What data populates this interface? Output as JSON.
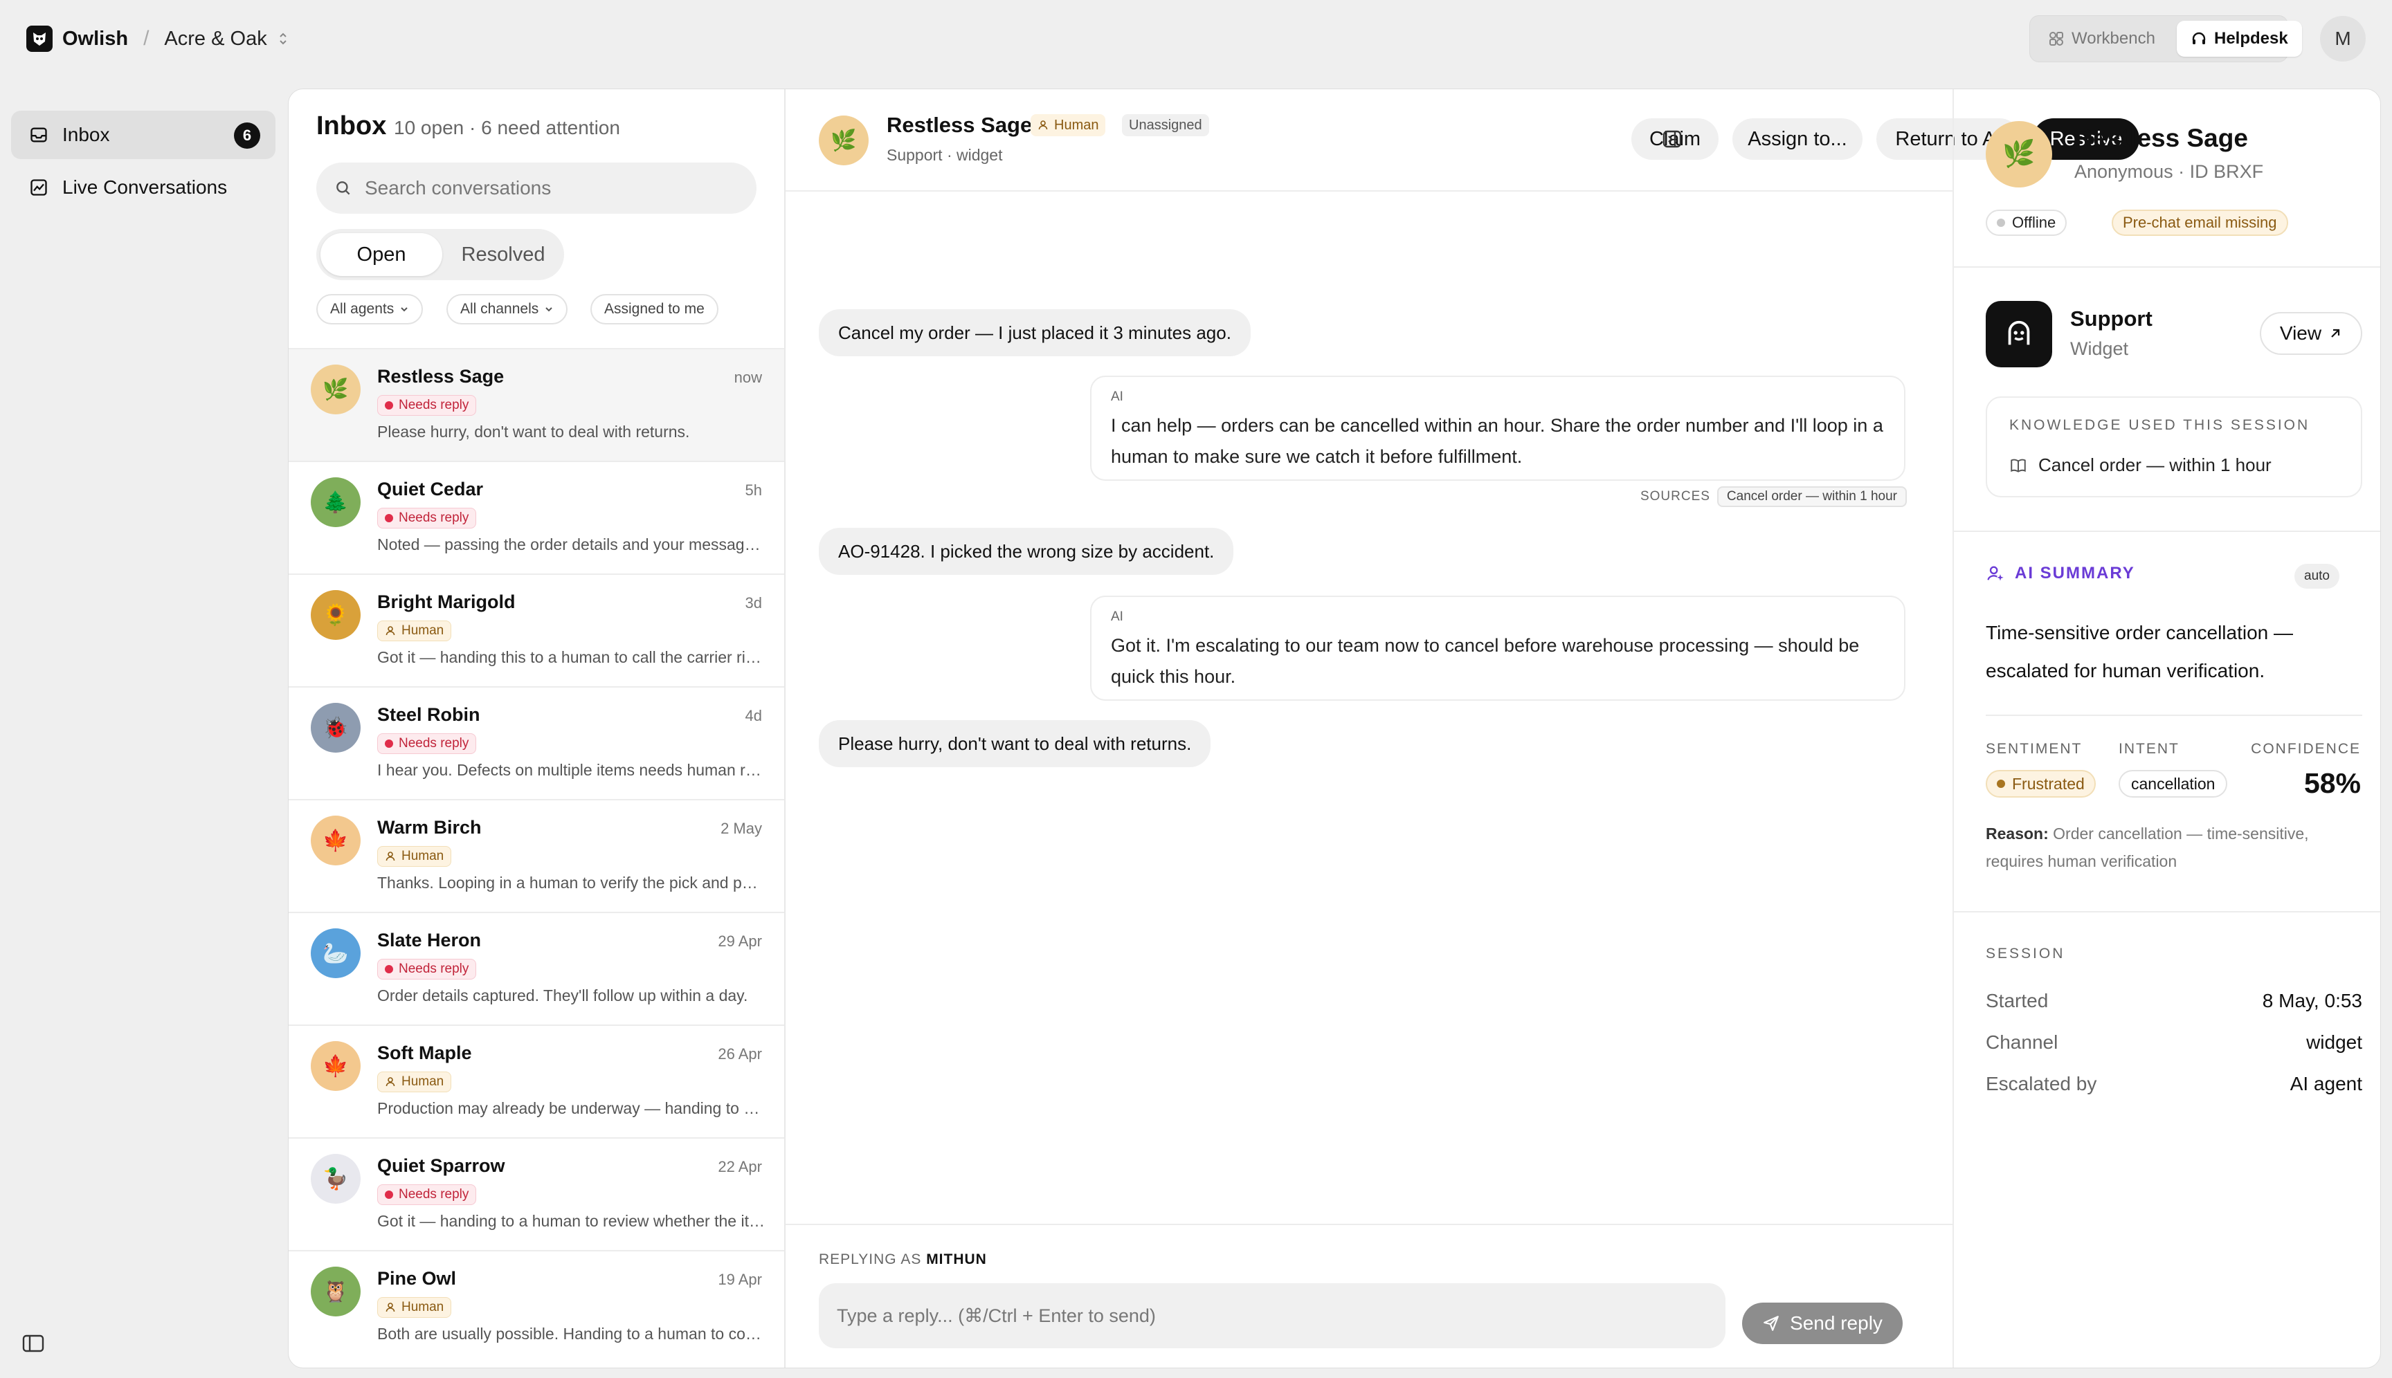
{
  "app": {
    "name": "Owlish",
    "workspace": "Acre & Oak"
  },
  "mode_switch": {
    "workbench": "Workbench",
    "helpdesk": "Helpdesk",
    "active": "Helpdesk"
  },
  "user": {
    "initial": "M"
  },
  "nav": {
    "inbox": {
      "label": "Inbox",
      "badge": "6",
      "icon": "inbox-icon"
    },
    "live": {
      "label": "Live Conversations",
      "icon": "chart-line-icon"
    }
  },
  "inbox": {
    "title": "Inbox",
    "counts": "10 open · 6 need attention",
    "search_placeholder": "Search conversations",
    "tabs": {
      "open": "Open",
      "resolved": "Resolved"
    },
    "filters": {
      "agents": "All agents",
      "channels": "All channels",
      "assigned": "Assigned to me"
    },
    "conversations": [
      {
        "name": "Restless Sage",
        "time": "now",
        "badge": "Needs reply",
        "preview": "Please hurry, don't want to deal with returns.",
        "emoji": "🌿",
        "color": "#f1cf95"
      },
      {
        "name": "Quiet Cedar",
        "time": "5h",
        "badge": "Needs reply",
        "preview": "Noted — passing the order details and your message to a human for review.",
        "emoji": "🌲",
        "color": "#7fae5a"
      },
      {
        "name": "Bright Marigold",
        "time": "3d",
        "badge": "Human",
        "preview": "Got it — handing this to a human to call the carrier right away.",
        "emoji": "🌻",
        "color": "#d9a13a"
      },
      {
        "name": "Steel Robin",
        "time": "4d",
        "badge": "Needs reply",
        "preview": "I hear you. Defects on multiple items needs human review right away.",
        "emoji": "🐞",
        "color": "#8e9cb0"
      },
      {
        "name": "Warm Birch",
        "time": "2 May",
        "badge": "Human",
        "preview": "Thanks. Looping in a human to verify the pick and pack process.",
        "emoji": "🍁",
        "color": "#f3c88e"
      },
      {
        "name": "Slate Heron",
        "time": "29 Apr",
        "badge": "Needs reply",
        "preview": "Order details captured. They'll follow up within a day.",
        "emoji": "🦢",
        "color": "#5aa2dc"
      },
      {
        "name": "Soft Maple",
        "time": "26 Apr",
        "badge": "Human",
        "preview": "Production may already be underway — handing to a human to check.",
        "emoji": "🍁",
        "color": "#f3c88e"
      },
      {
        "name": "Quiet Sparrow",
        "time": "22 Apr",
        "badge": "Needs reply",
        "preview": "Got it — handing to a human to review whether the item can be swapped.",
        "emoji": "🦆",
        "color": "#e8e8ee"
      },
      {
        "name": "Pine Owl",
        "time": "19 Apr",
        "badge": "Human",
        "preview": "Both are usually possible. Handing to a human to confirm.",
        "emoji": "🦉",
        "color": "#7fae5a"
      }
    ]
  },
  "chat": {
    "customer": "Restless Sage",
    "mode_badge": "Human",
    "assign_badge": "Unassigned",
    "sub": "Support · widget",
    "actions": {
      "claim": "Claim",
      "assign": "Assign to...",
      "return_ai": "Return to AI",
      "resolve": "Resolve"
    },
    "messages": [
      {
        "role": "user",
        "text": "Cancel my order — I just placed it 3 minutes ago."
      },
      {
        "role": "ai",
        "label": "AI",
        "text": "I can help — orders can be cancelled within an hour. Share the order number and I'll loop in a human to make sure we catch it before fulfillment."
      },
      {
        "role": "user",
        "text": "AO-91428. I picked the wrong size by accident."
      },
      {
        "role": "ai",
        "label": "AI",
        "text": "Got it. I'm escalating to our team now to cancel before warehouse processing — should be quick this hour."
      },
      {
        "role": "user",
        "text": "Please hurry, don't want to deal with returns."
      }
    ],
    "sources_label": "SOURCES",
    "source_chip": "Cancel order — within 1 hour",
    "replying_label": "REPLYING AS",
    "replying_name": "MITHUN",
    "reply_placeholder": "Type a reply... (⌘/Ctrl + Enter to send)",
    "send_label": "Send reply"
  },
  "info": {
    "name": "Restless Sage",
    "sub": "Anonymous · ID BRXF",
    "status": "Offline",
    "warning": "Pre-chat email missing",
    "agent": {
      "name": "Support",
      "channel": "Widget",
      "view": "View"
    },
    "knowledge": {
      "title": "KNOWLEDGE USED THIS SESSION",
      "item": "Cancel order — within 1 hour"
    },
    "ai_summary": {
      "title": "AI SUMMARY",
      "auto": "auto",
      "text": "Time-sensitive order cancellation — escalated for human verification.",
      "sentiment_label": "SENTIMENT",
      "intent_label": "INTENT",
      "confidence_label": "CONFIDENCE",
      "sentiment": "Frustrated",
      "intent": "cancellation",
      "confidence": "58%",
      "reason_label": "Reason:",
      "reason": "Order cancellation — time-sensitive, requires human verification"
    },
    "session": {
      "title": "SESSION",
      "rows": [
        {
          "k": "Started",
          "v": "8 May, 0:53"
        },
        {
          "k": "Channel",
          "v": "widget"
        },
        {
          "k": "Escalated by",
          "v": "AI agent"
        }
      ]
    }
  },
  "colors": {
    "accent": "#111111",
    "needs_reply": "#c1243a",
    "human": "#8a5a12",
    "ai_summary": "#6a3bd6"
  }
}
